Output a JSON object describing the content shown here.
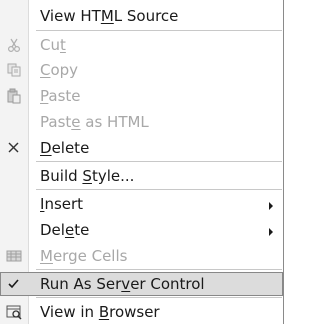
{
  "context_menu": {
    "items": [
      {
        "id": "view-html-source",
        "parts": [
          "View HT",
          "M",
          "L Source"
        ],
        "disabled": false
      },
      {
        "id": "cut",
        "parts": [
          "Cu",
          "t",
          ""
        ],
        "disabled": true,
        "icon": "scissors-icon"
      },
      {
        "id": "copy",
        "parts": [
          "",
          "C",
          "opy"
        ],
        "disabled": true,
        "icon": "copy-icon"
      },
      {
        "id": "paste",
        "parts": [
          "",
          "P",
          "aste"
        ],
        "disabled": true,
        "icon": "paste-icon"
      },
      {
        "id": "paste-as-html",
        "parts": [
          "Past",
          "e",
          " as HTML"
        ],
        "disabled": true
      },
      {
        "id": "delete",
        "parts": [
          "",
          "D",
          "elete"
        ],
        "disabled": false,
        "icon": "delete-x-icon"
      },
      {
        "id": "build-style",
        "parts": [
          "Build ",
          "S",
          "tyle..."
        ],
        "disabled": false
      },
      {
        "id": "insert",
        "parts": [
          "",
          "I",
          "nsert"
        ],
        "disabled": false,
        "submenu": true
      },
      {
        "id": "delete-submenu",
        "parts": [
          "Del",
          "e",
          "te"
        ],
        "disabled": false,
        "submenu": true
      },
      {
        "id": "merge-cells",
        "parts": [
          "",
          "M",
          "erge Cells"
        ],
        "disabled": true,
        "icon": "merge-cells-icon"
      },
      {
        "id": "run-as-server-control",
        "parts": [
          "Run As Ser",
          "v",
          "er Control"
        ],
        "disabled": false,
        "selected": true,
        "icon": "checkmark-icon"
      },
      {
        "id": "view-in-browser",
        "parts": [
          "View in ",
          "B",
          "rowser"
        ],
        "disabled": false,
        "icon": "browser-icon"
      }
    ]
  },
  "colors": {
    "background": "#ffffff",
    "disabled_text": "#a8a8a8",
    "selected_background": "#dcdcdc",
    "selected_border": "#888888"
  }
}
